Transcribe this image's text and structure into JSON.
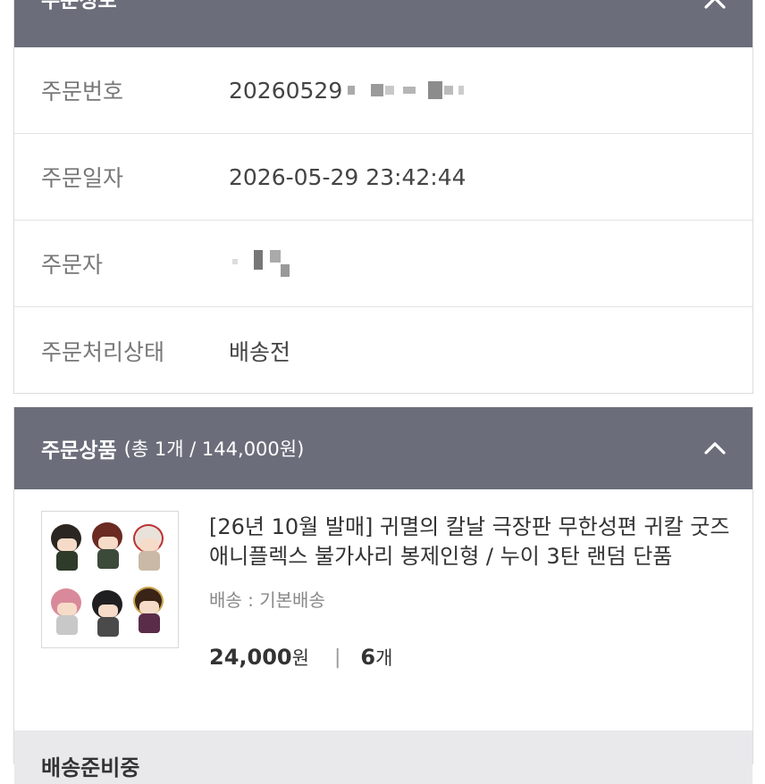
{
  "order_info": {
    "title": "주문정보",
    "rows": [
      {
        "label": "주문번호",
        "value": "20260529"
      },
      {
        "label": "주문일자",
        "value": "2026-05-29 23:42:44"
      },
      {
        "label": "주문자",
        "value": ""
      },
      {
        "label": "주문처리상태",
        "value": "배송전"
      }
    ]
  },
  "order_products": {
    "title": "주문상품",
    "summary": "(총 1개 / 144,000원)",
    "item": {
      "name": "[26년 10월 발매] 귀멸의 칼날 극장판 무한성편 귀칼 굿즈 애니플렉스 불가사리 봉제인형 / 누이 3탄 랜덤 단품",
      "shipping": "배송 : 기본배송",
      "price": "24,000",
      "price_unit": "원",
      "separator": "|",
      "quantity": "6",
      "quantity_unit": "개"
    }
  },
  "next_section": {
    "title": "배송준비중"
  },
  "colors": {
    "header_bg": "#6b6e7a",
    "footer_bg": "#e9e9ec"
  },
  "icons": {
    "collapse": "chevron-up-icon"
  }
}
